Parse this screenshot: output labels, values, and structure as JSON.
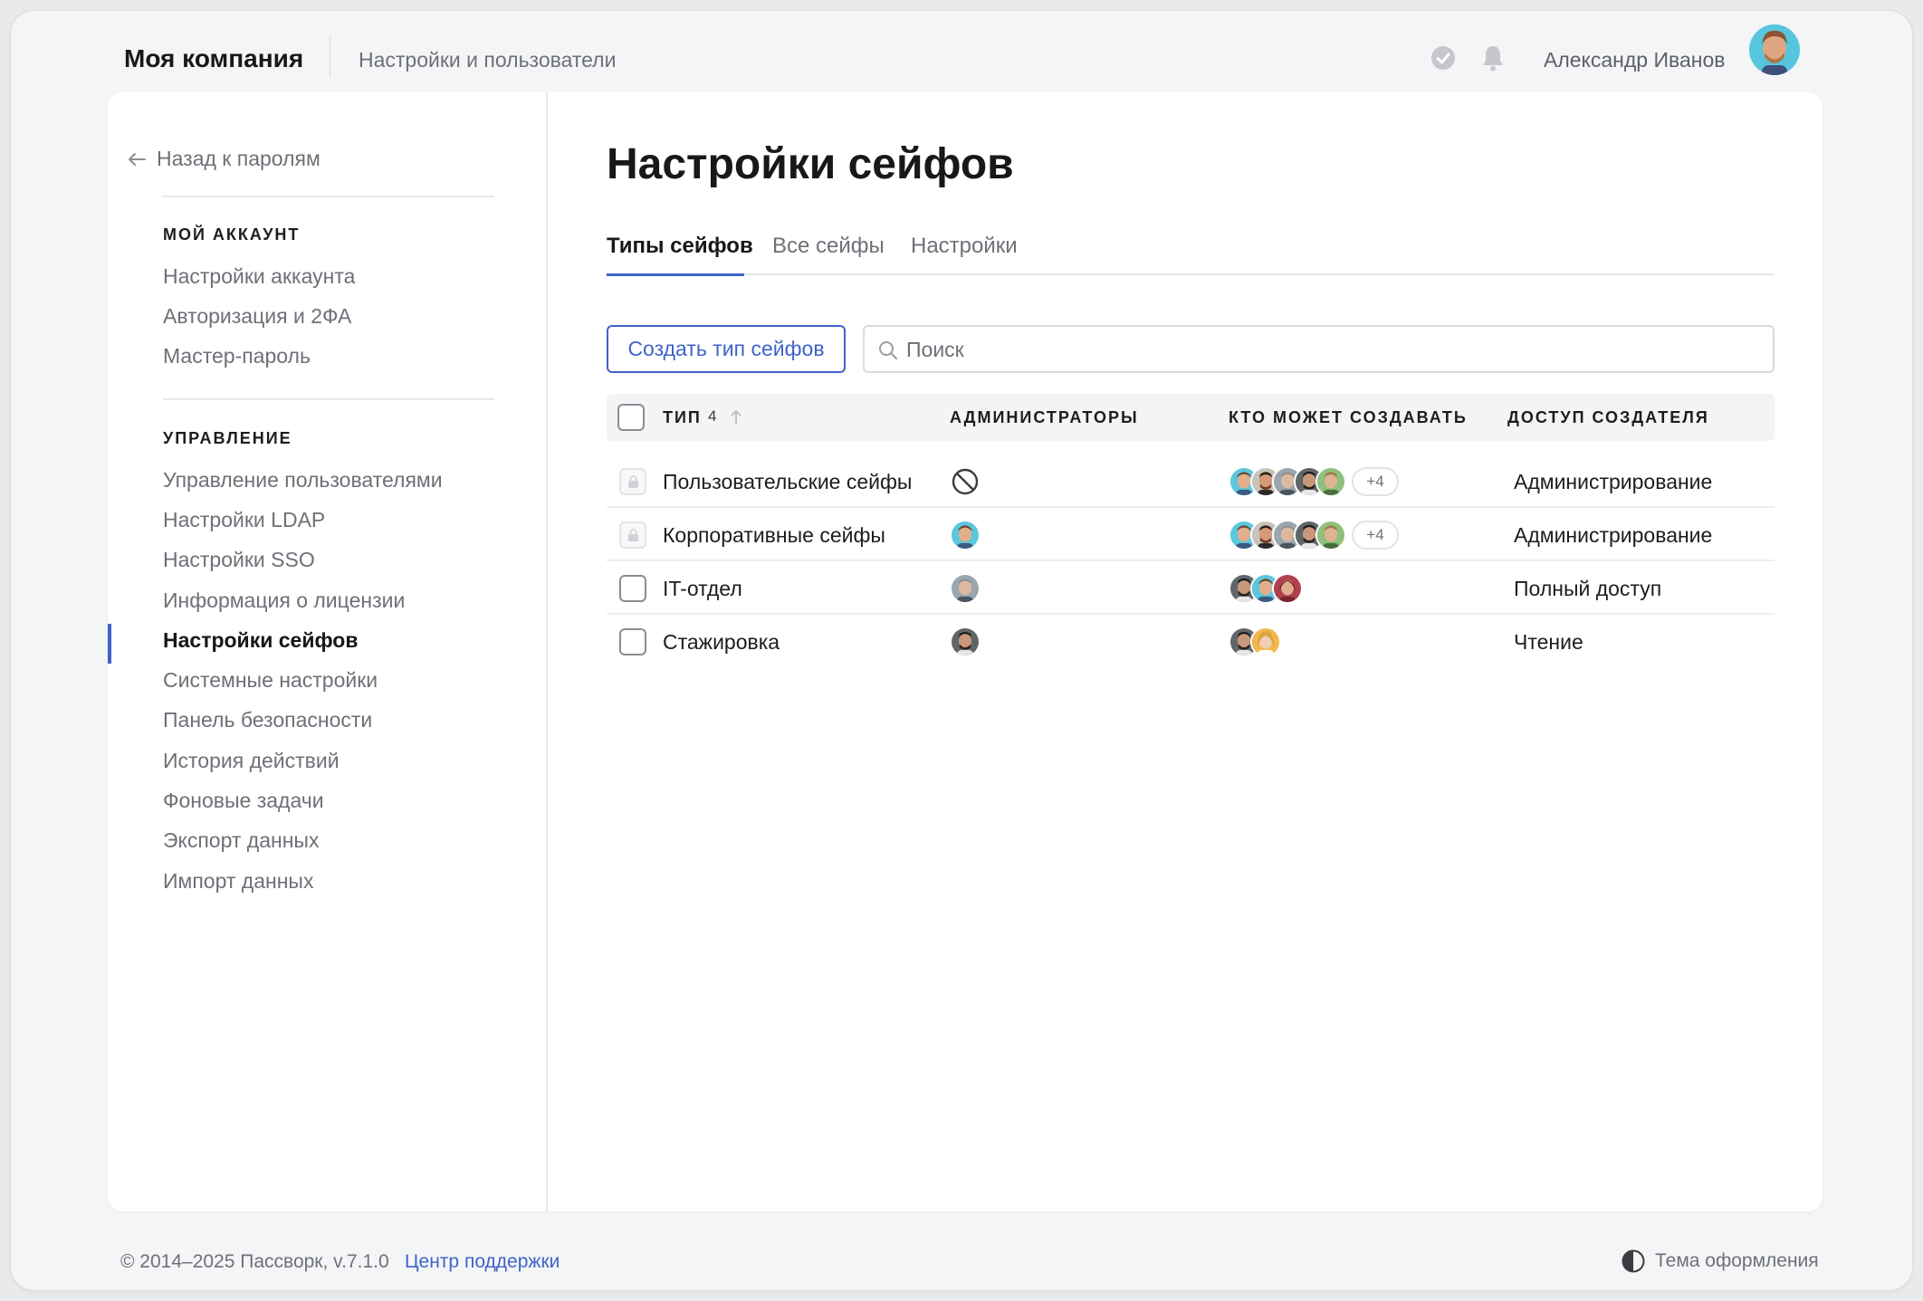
{
  "header": {
    "brand": "Моя компания",
    "breadcrumb": "Настройки и пользователи",
    "user_name": "Александр Иванов"
  },
  "sidebar": {
    "back_label": "Назад к паролям",
    "sections": [
      {
        "title": "МОЙ АККАУНТ",
        "items": [
          "Настройки аккаунта",
          "Авторизация и 2ФА",
          "Мастер-пароль"
        ]
      },
      {
        "title": "УПРАВЛЕНИЕ",
        "items": [
          "Управление пользователями",
          "Настройки LDAP",
          "Настройки SSO",
          "Информация о лицензии",
          "Настройки сейфов",
          "Системные настройки",
          "Панель безопасности",
          "История действий",
          "Фоновые задачи",
          "Экспорт данных",
          "Импорт данных"
        ]
      }
    ],
    "active_item": "Настройки сейфов"
  },
  "main": {
    "title": "Настройки сейфов",
    "tabs": [
      "Типы сейфов",
      "Все сейфы",
      "Настройки"
    ],
    "active_tab": "Типы сейфов",
    "create_button": "Создать тип сейфов",
    "search_placeholder": "Поиск",
    "table": {
      "columns": [
        "ТИП",
        "АДМИНИСТРАТОРЫ",
        "КТО МОЖЕТ СОЗДАВАТЬ",
        "ДОСТУП СОЗДАТЕЛЯ"
      ],
      "type_count": "4",
      "rows": [
        {
          "type": "Пользовательские сейфы",
          "locked": true,
          "admins": "none",
          "creators_more": "+4",
          "access": "Администрирование"
        },
        {
          "type": "Корпоративные сейфы",
          "locked": true,
          "admins": "one",
          "creators_more": "+4",
          "access": "Администрирование"
        },
        {
          "type": "IT-отдел",
          "locked": false,
          "admins": "one",
          "creators_more": "",
          "access": "Полный доступ"
        },
        {
          "type": "Стажировка",
          "locked": false,
          "admins": "one",
          "creators_more": "",
          "access": "Чтение"
        }
      ]
    }
  },
  "footer": {
    "copyright": "© 2014–2025 Пассворк, v.7.1.0",
    "support_link": "Центр поддержки",
    "theme_label": "Тема оформления"
  },
  "colors": {
    "accent": "#3f63c9",
    "background": "#f4f5f6",
    "text_muted": "#6d7077"
  }
}
